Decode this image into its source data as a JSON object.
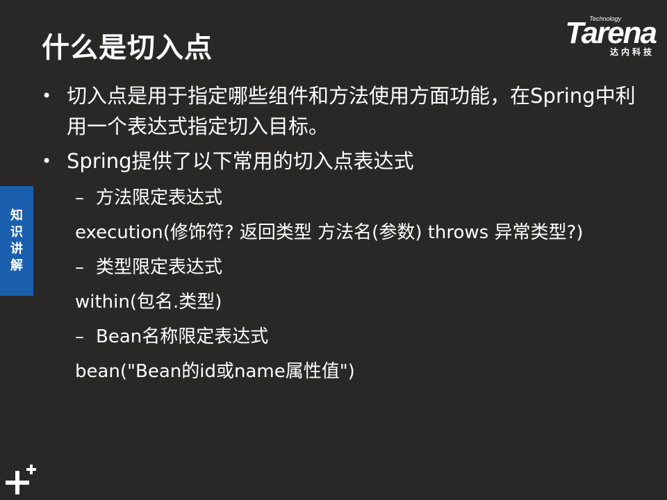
{
  "title": "什么是切入点",
  "logo": {
    "tech": "Technology",
    "brand": "Tarena",
    "cn": "达内科技"
  },
  "side_tab": [
    "知",
    "识",
    "讲",
    "解"
  ],
  "bullets": [
    {
      "marker": "•",
      "text": "切入点是用于指定哪些组件和方法使用方面功能，在Spring中利用一个表达式指定切入目标。"
    },
    {
      "marker": "•",
      "text": "Spring提供了以下常用的切入点表达式"
    }
  ],
  "sub_items": [
    {
      "dash": "–",
      "text": "方法限定表达式"
    },
    {
      "dash": "",
      "text": "execution(修饰符? 返回类型  方法名(参数)  throws 异常类型?)"
    },
    {
      "dash": "–",
      "text": "类型限定表达式"
    },
    {
      "dash": "",
      "text": "within(包名.类型)"
    },
    {
      "dash": "–",
      "text": "Bean名称限定表达式"
    },
    {
      "dash": "",
      "text": "bean(\"Bean的id或name属性值\")"
    }
  ]
}
